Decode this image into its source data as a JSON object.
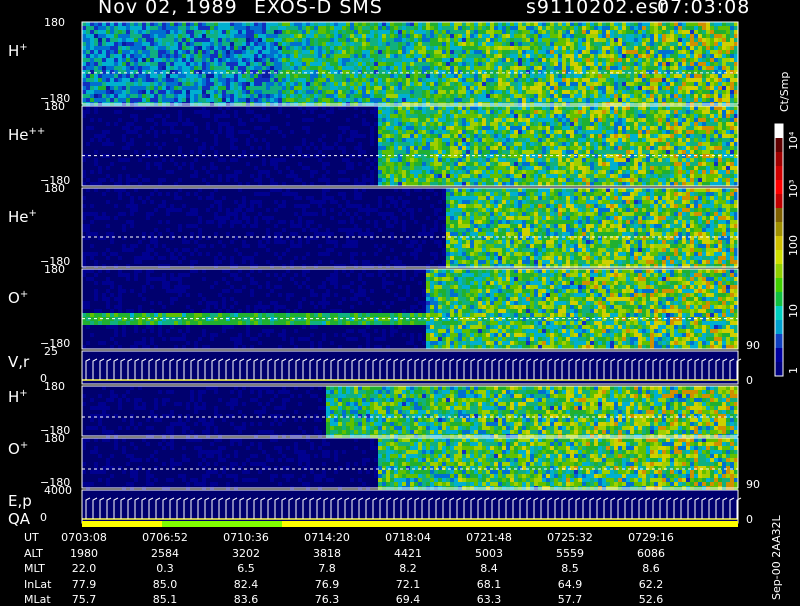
{
  "header": {
    "date": "Nov 02, 1989",
    "title": "EXOS-D SMS",
    "file": "s9110202.esr",
    "time": "07:03:08"
  },
  "chart_data": {
    "type": "heatmap",
    "panels": [
      {
        "label": "H",
        "charge": "+",
        "ytop": "180",
        "ybottom": "−180",
        "kind": "spec",
        "seed": 11
      },
      {
        "label": "He",
        "charge": "++",
        "ytop": "180",
        "ybottom": "−180",
        "kind": "spec",
        "seed": 23
      },
      {
        "label": "He",
        "charge": "+",
        "ytop": "180",
        "ybottom": "−180",
        "kind": "spec",
        "seed": 37
      },
      {
        "label": "O",
        "charge": "+",
        "ytop": "180",
        "ybottom": "−180",
        "kind": "spec",
        "seed": 41,
        "right_tick": "90"
      },
      {
        "label": "V,r",
        "charge": "",
        "ytop": "25",
        "ybottom": "0",
        "kind": "line",
        "right_tick": "0"
      },
      {
        "label": "H",
        "charge": "+",
        "ytop": "180",
        "ybottom": "−180",
        "kind": "spec",
        "seed": 53
      },
      {
        "label": "O",
        "charge": "+",
        "ytop": "180",
        "ybottom": "−180",
        "kind": "spec",
        "seed": 67,
        "right_tick": "90"
      },
      {
        "label": "E,p",
        "charge": "",
        "ytop": "4000",
        "ybottom": "0",
        "kind": "line",
        "right_tick": "0"
      }
    ],
    "qa_label": "QA",
    "colorbar": {
      "unit": "Ct/Smp",
      "ticks": [
        "1",
        "10",
        "100",
        "10³",
        "10⁴"
      ],
      "colors": [
        "#000080",
        "#0000a0",
        "#1040c0",
        "#00a0d0",
        "#00d0c0",
        "#10c040",
        "#40d000",
        "#90d000",
        "#d0e000",
        "#d0c000",
        "#a09000",
        "#806000",
        "#c00000",
        "#ff0000",
        "#d00000",
        "#a00000",
        "#600000",
        "#ffffff"
      ]
    },
    "ephemeris": {
      "rows": [
        "UT",
        "ALT",
        "MLT",
        "InLat",
        "MLat"
      ],
      "columns": [
        [
          "0703:08",
          "1980",
          "22.0",
          "77.9",
          "75.7"
        ],
        [
          "0706:52",
          "2584",
          "0.3",
          "85.0",
          "85.1"
        ],
        [
          "0710:36",
          "3202",
          "6.5",
          "82.4",
          "83.6"
        ],
        [
          "0714:20",
          "3818",
          "7.8",
          "76.9",
          "76.3"
        ],
        [
          "0718:04",
          "4421",
          "8.2",
          "72.1",
          "69.4"
        ],
        [
          "0721:48",
          "5003",
          "8.4",
          "68.1",
          "63.3"
        ],
        [
          "0725:32",
          "5559",
          "8.5",
          "64.9",
          "57.7"
        ],
        [
          "0729:16",
          "6086",
          "8.6",
          "62.2",
          "52.6"
        ]
      ]
    },
    "footer": "Sep-00 2AA32L"
  }
}
